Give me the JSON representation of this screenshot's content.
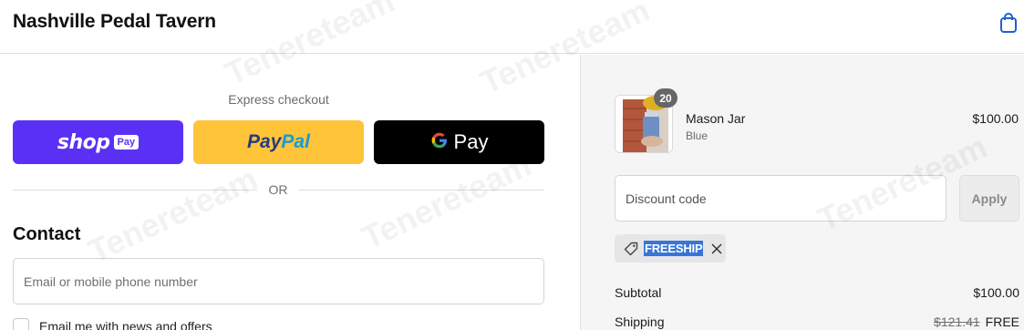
{
  "header": {
    "store_name": "Nashville Pedal Tavern",
    "cart_icon": "shopping-bag-icon"
  },
  "express": {
    "label": "Express checkout",
    "shop_pay": {
      "word": "shop",
      "badge": "Pay"
    },
    "paypal": {
      "part1": "Pay",
      "part2": "Pal"
    },
    "google_pay": {
      "word": "Pay"
    },
    "divider_text": "OR"
  },
  "contact": {
    "heading": "Contact",
    "input_placeholder": "Email or mobile phone number",
    "newsletter_label": "Email me with news and offers",
    "newsletter_checked": false
  },
  "order": {
    "item": {
      "name": "Mason Jar",
      "variant": "Blue",
      "quantity": "20",
      "price": "$100.00"
    },
    "discount": {
      "placeholder": "Discount code",
      "apply_label": "Apply",
      "applied_code": "FREESHIP"
    },
    "summary": {
      "subtotal_label": "Subtotal",
      "subtotal_value": "$100.00",
      "shipping_label": "Shipping",
      "shipping_original": "$121.41",
      "shipping_value": "FREE"
    }
  },
  "watermark": "Tenereteam",
  "colors": {
    "shop_pay": "#5a31f4",
    "paypal": "#ffc439",
    "google_pay": "#000000",
    "highlight": "#3875d7"
  }
}
